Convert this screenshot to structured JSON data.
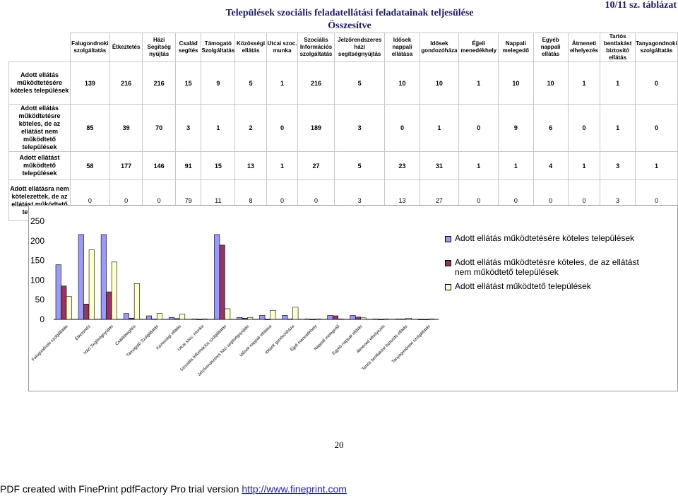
{
  "page": {
    "title_line1": "Települések szociális feladatellátási feladatainak teljesülése",
    "title_line2": "Összesítve",
    "table_number": "10/11 sz. táblázat",
    "page_number": "20"
  },
  "table": {
    "columns": [
      "Falugondnoki szolgáltatás",
      "Étkeztetés",
      "Házi Segítség nyújtás",
      "Család segítés",
      "Támogató Szolgáltatás",
      "Közösségi ellátás",
      "Utcai szoc. munka",
      "Szociális Információs szolgáltatás",
      "Jelzőrendszeres házi segítségnyújtás",
      "Idősek nappali ellátása",
      "Idősek gondozóháza",
      "Éjjeli menedékhely",
      "Nappali melegedő",
      "Egyéb nappali ellátás",
      "Átmeneti elhelyezés",
      "Tartós bentlakást biztosító ellátás",
      "Tanyagondnoki szolgáltatás"
    ],
    "rows": [
      {
        "label": "Adott ellátás működtetésére köteles települések",
        "values": [
          "139",
          "216",
          "216",
          "15",
          "9",
          "5",
          "1",
          "216",
          "5",
          "10",
          "10",
          "1",
          "10",
          "10",
          "1",
          "1",
          "0"
        ]
      },
      {
        "label": "Adott ellátás működtetésre köteles, de az ellátást nem működtető települések",
        "values": [
          "85",
          "39",
          "70",
          "3",
          "1",
          "2",
          "0",
          "189",
          "3",
          "0",
          "1",
          "0",
          "9",
          "6",
          "0",
          "1",
          "0"
        ]
      },
      {
        "label": "Adott ellátást működtető települések",
        "values": [
          "58",
          "177",
          "146",
          "91",
          "15",
          "13",
          "1",
          "27",
          "5",
          "23",
          "31",
          "1",
          "1",
          "4",
          "1",
          "3",
          "1"
        ]
      },
      {
        "label": "Adott ellátásra nem kötelezettek, de az ellátást működtető települések",
        "values": [
          "0",
          "0",
          "0",
          "79",
          "11",
          "8",
          "0",
          "0",
          "3",
          "13",
          "27",
          "0",
          "0",
          "0",
          "0",
          "3",
          "0"
        ]
      }
    ]
  },
  "chart_data": {
    "type": "bar",
    "categories": [
      "Falugondnoki szolgáltatás",
      "Étkeztetés",
      "Házi Segítségnyújtás",
      "Családsegítés",
      "Támogató Szolgáltatás",
      "Közösségi ellátás",
      "Utcai szoc. munka",
      "Szociális Információs szolgáltatás",
      "Jelzőrendszeres házi segítségnyújtás",
      "Idősek nappali ellátása",
      "Idősek gondozóháza",
      "Éjjeli menedékhely",
      "Nappali melegedő",
      "Egyéb nappali ellátás",
      "Átmeneti elhelyezés",
      "Tartós bentlakást biztosító ellátás",
      "Tanyagondnoki szolgáltatás"
    ],
    "series": [
      {
        "name": "Adott ellátás működtetésére köteles települések",
        "color": "#9999ff",
        "values": [
          139,
          216,
          216,
          15,
          9,
          5,
          1,
          216,
          5,
          10,
          10,
          1,
          10,
          10,
          1,
          1,
          0
        ]
      },
      {
        "name": "Adott ellátás működtetésre köteles, de az ellátást nem működtető települések",
        "color": "#993366",
        "values": [
          85,
          39,
          70,
          3,
          1,
          2,
          0,
          189,
          3,
          0,
          1,
          0,
          9,
          6,
          0,
          1,
          0
        ]
      },
      {
        "name": "Adott ellátást működtető települések",
        "color": "#ffffcc",
        "values": [
          58,
          177,
          146,
          91,
          15,
          13,
          1,
          27,
          5,
          23,
          31,
          1,
          1,
          4,
          1,
          3,
          1
        ]
      }
    ],
    "ylim": [
      0,
      250
    ],
    "yticks": [
      "0",
      "50",
      "100",
      "150",
      "200",
      "250"
    ],
    "grid": false,
    "legend_position": "right"
  },
  "footer": {
    "text": "PDF created with FinePrint pdfFactory Pro trial version ",
    "link": "http://www.fineprint.com"
  }
}
